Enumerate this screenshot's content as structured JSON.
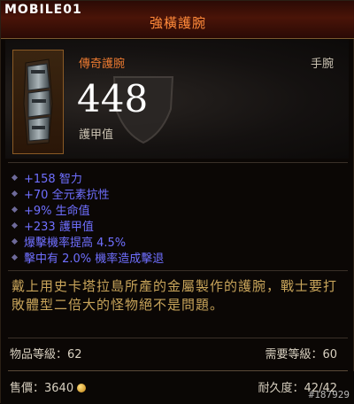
{
  "header": {
    "site_logo": "MOBILE01",
    "title": "強橫護腕"
  },
  "item": {
    "rarity_type": "傳奇護腕",
    "slot": "手腕",
    "armor_value": "448",
    "armor_label": "護甲值",
    "icon": "bracers-icon"
  },
  "stats": [
    {
      "text": "+158 智力"
    },
    {
      "text": "+70 全元素抗性"
    },
    {
      "text": "+9% 生命值"
    },
    {
      "text": "+233 護甲值"
    },
    {
      "text": "爆擊機率提高 4.5%"
    },
    {
      "text": "擊中有 2.0% 機率造成擊退"
    }
  ],
  "flavor_text": "戴上用史卡塔拉島所產的金屬製作的護腕，戰士要打敗體型二倍大的怪物絕不是問題。",
  "requirements": {
    "item_level": "物品等級：62",
    "required_level": "需要等級：60"
  },
  "footer": {
    "price": "售價：3640",
    "durability": "耐久度：42/42",
    "watermark": "#187929"
  },
  "colors": {
    "title": "#ff8a3a",
    "stat": "#6f6fff",
    "flavor": "#c8a45a",
    "legendary": "#e87830"
  }
}
